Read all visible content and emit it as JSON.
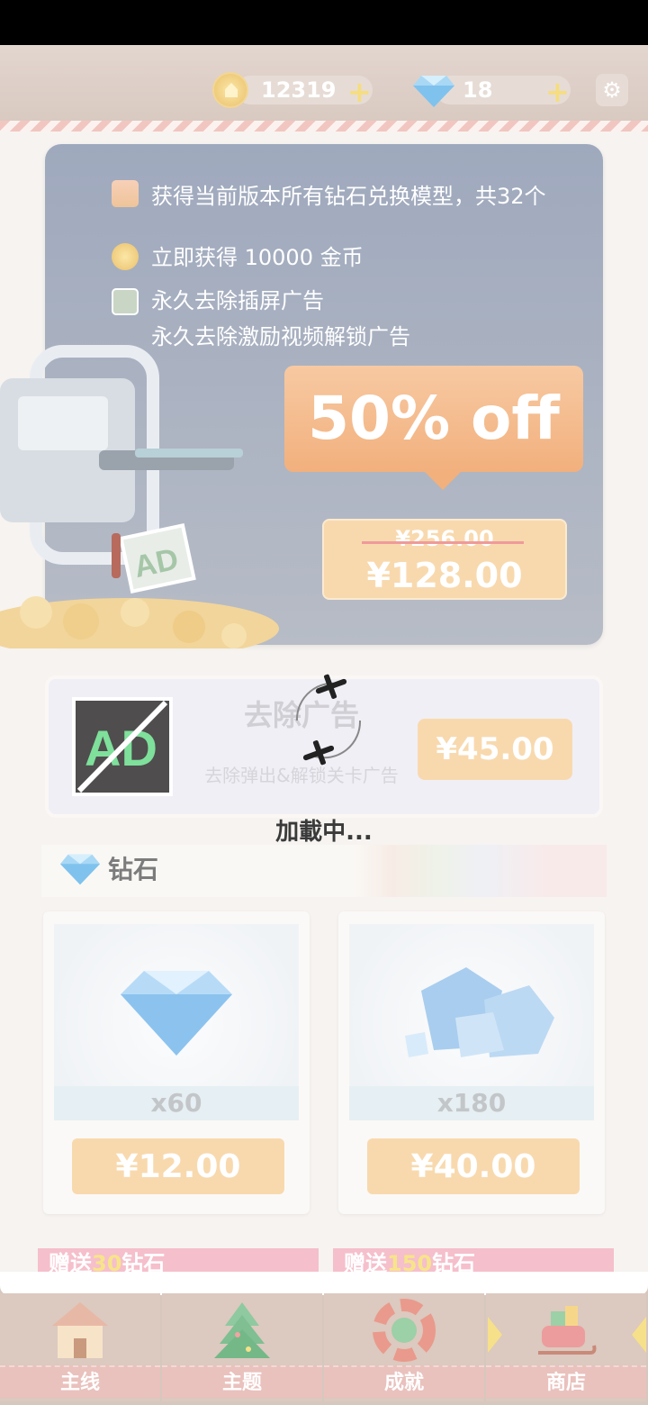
{
  "header": {
    "coins": "12319",
    "coins_plus": "+",
    "gems": "18",
    "gems_plus": "+",
    "settings_icon": "gear-icon"
  },
  "promo": {
    "perk1": "获得当前版本所有钻石兑换模型，共32个",
    "perk2": "立即获得 10000 金币",
    "perk3_line1": "永久去除插屏广告",
    "perk3_line2": "永久去除激励视频解锁广告",
    "discount": "50% off",
    "old_price": "¥256.00",
    "new_price": "¥128.00",
    "ad_art_text": "AD"
  },
  "remove_ads": {
    "title": "去除广告",
    "subtitle": "去除弹出&解锁关卡广告",
    "price": "¥45.00",
    "art_text": "AD"
  },
  "loading": "加載中...",
  "section": {
    "label": "钻石"
  },
  "products": [
    {
      "qty": "x60",
      "price": "¥12.00"
    },
    {
      "qty": "x180",
      "price": "¥40.00"
    }
  ],
  "gifts": [
    {
      "prefix": "赠送",
      "amount": "30",
      "suffix": "钻石"
    },
    {
      "prefix": "赠送",
      "amount": "150",
      "suffix": "钻石"
    }
  ],
  "nav": [
    {
      "label": "主线",
      "icon": "house-icon"
    },
    {
      "label": "主题",
      "icon": "christmas-tree-icon"
    },
    {
      "label": "成就",
      "icon": "achievement-icon"
    },
    {
      "label": "商店",
      "icon": "sleigh-icon",
      "selected": true
    }
  ],
  "colors": {
    "price_button": "#f8d9ae",
    "discount_banner": "#f2b07d",
    "nav_label": "#e9c1bd"
  }
}
